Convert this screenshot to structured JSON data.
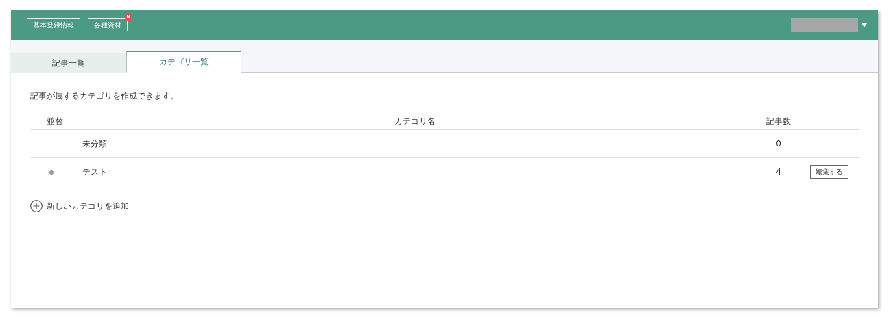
{
  "header": {
    "nav_buttons": [
      {
        "label": "基本登録情報"
      },
      {
        "label": "各種資材",
        "badge": "N"
      }
    ]
  },
  "tabs": [
    {
      "label": "記事一覧",
      "selected": false
    },
    {
      "label": "カテゴリ一覧",
      "selected": true
    }
  ],
  "description": "記事が属するカテゴリを作成できます。",
  "table": {
    "columns": [
      "並替",
      "カテゴリ名",
      "記事数"
    ],
    "rows": [
      {
        "name": "未分類",
        "count": "0",
        "draggable": false
      },
      {
        "name": "テスト",
        "count": "4",
        "draggable": true,
        "edit_label": "編集する"
      }
    ]
  },
  "add_link": "新しいカテゴリを追加"
}
